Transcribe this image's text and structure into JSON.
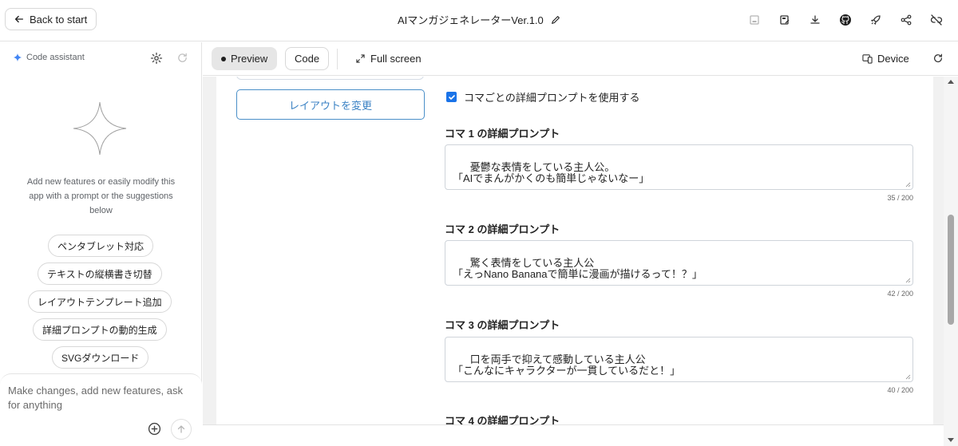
{
  "header": {
    "back_label": "Back to start",
    "app_title": "AIマンガジェネレーターVer.1.0",
    "icons": [
      "save-icon",
      "save-as-icon",
      "download-icon",
      "github-icon",
      "deploy-rocket-icon",
      "share-icon",
      "unlink-icon"
    ]
  },
  "assistant": {
    "header_label": "Code assistant",
    "description": "Add new features or easily modify this app with a prompt or the suggestions below",
    "suggestions": [
      "ペンタブレット対応",
      "テキストの縦横書き切替",
      "レイアウトテンプレート追加",
      "詳細プロンプトの動的生成",
      "SVGダウンロード"
    ],
    "input_placeholder": "Make changes, add new features, ask for anything"
  },
  "toolbar": {
    "preview_label": "Preview",
    "code_label": "Code",
    "fullscreen_label": "Full screen",
    "device_label": "Device"
  },
  "app": {
    "layout_button": "レイアウトを変更",
    "checkbox_label": "コマごとの詳細プロンプトを使用する",
    "checkbox_checked": true,
    "panels": [
      {
        "label": "コマ 1 の詳細プロンプト",
        "text": "憂鬱な表情をしている主人公。\n「AIでまんがかくのも簡単じゃないなー」",
        "counter": "35 / 200"
      },
      {
        "label": "コマ 2 の詳細プロンプト",
        "text": "驚く表情をしている主人公\n「えっNano Bananaで簡単に漫画が描けるって！？」",
        "counter": "42 / 200"
      },
      {
        "label": "コマ 3 の詳細プロンプト",
        "text": "口を両手で抑えて感動している主人公\n「こんなにキャラクターが一貫しているだと！」",
        "counter": "40 / 200"
      },
      {
        "label": "コマ 4 の詳細プロンプト"
      }
    ]
  },
  "colors": {
    "accent": "#1a73e8",
    "layout_button_border": "#4a8fc8",
    "sparkle": "#4285f4"
  }
}
